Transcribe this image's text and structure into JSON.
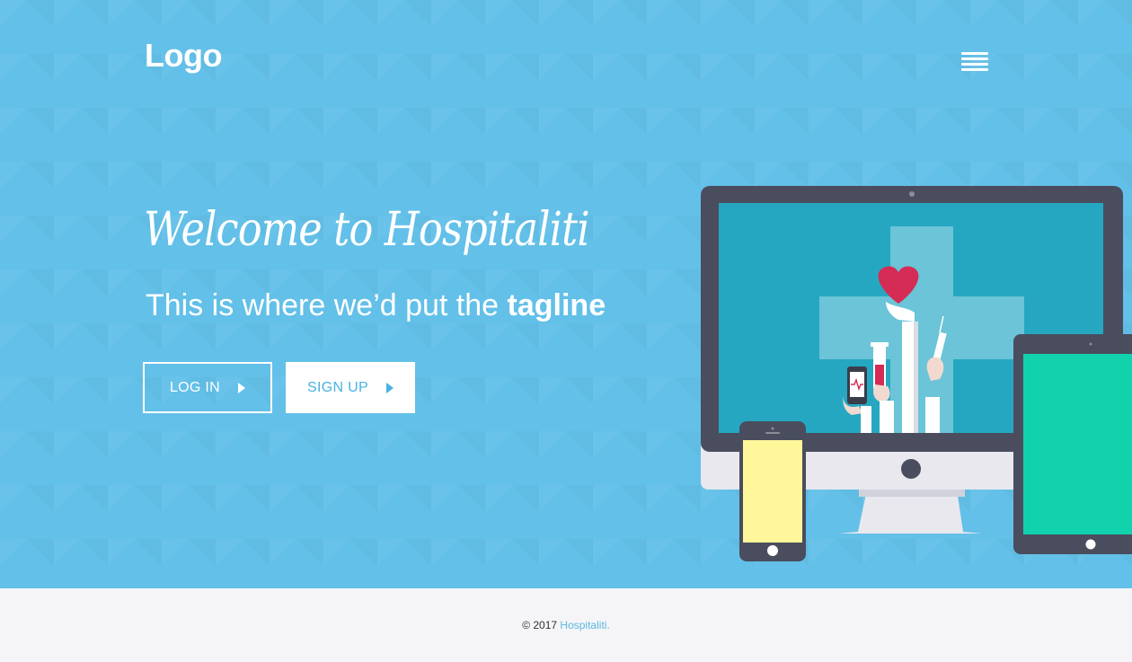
{
  "header": {
    "logo": "Logo",
    "menu_icon": "hamburger-menu-icon"
  },
  "hero": {
    "welcome": "Welcome to Hospitaliti",
    "tagline_prefix": "This is where we’d put the",
    "tagline_emphasis": "tagline",
    "login_label": "LOG IN",
    "signup_label": "SIGN UP",
    "arrow_icon": "play-arrow-icon",
    "illustration": "devices-illustration"
  },
  "footer": {
    "copyright": "© 2017",
    "brand": "Hospitaliti."
  },
  "colors": {
    "hero_bg": "#63c0e8",
    "accent": "#47b3e1",
    "footer_bg": "#f5f5f8",
    "monitor_screen": "#26a7c1",
    "tablet_screen": "#12d2ae",
    "phone_screen": "#fff799",
    "heart": "#d42c54"
  }
}
